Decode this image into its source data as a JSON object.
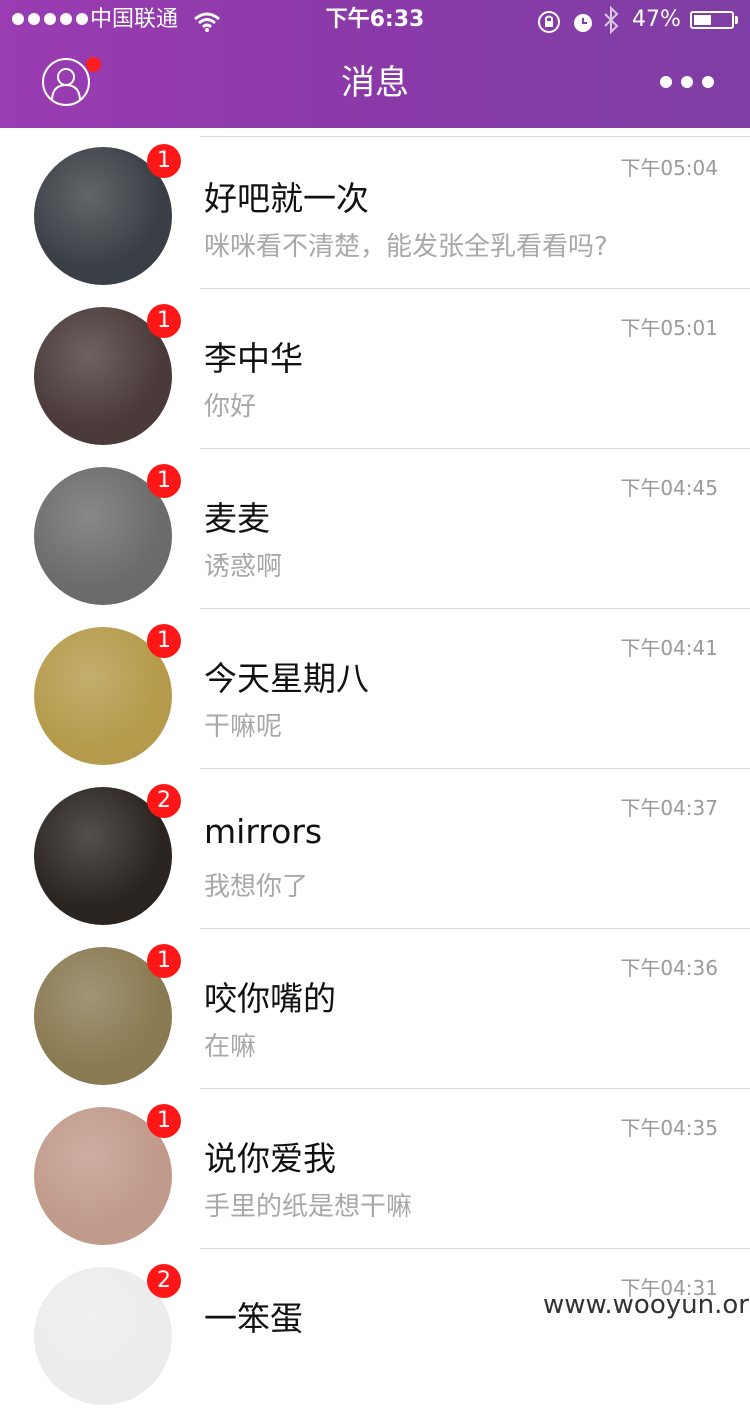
{
  "status_bar": {
    "carrier": "中国联通",
    "time": "下午6:33",
    "battery_text": "47%",
    "battery_level": 0.47
  },
  "nav": {
    "title": "消息",
    "profile_icon": "person-icon",
    "more_icon": "ellipsis-icon"
  },
  "conversations": [
    {
      "name": "好吧就一次",
      "preview": "咪咪看不清楚，能发张全乳看看吗?",
      "time": "下午05:04",
      "unread": "1",
      "avatar_color": "#3a3f45"
    },
    {
      "name": "李中华",
      "preview": "你好",
      "time": "下午05:01",
      "unread": "1",
      "avatar_color": "#4a3a3a"
    },
    {
      "name": "麦麦",
      "preview": "诱惑啊",
      "time": "下午04:45",
      "unread": "1",
      "avatar_color": "#6b6b6b"
    },
    {
      "name": "今天星期八",
      "preview": "干嘛呢",
      "time": "下午04:41",
      "unread": "1",
      "avatar_color": "#b49a4a"
    },
    {
      "name": "mirrors",
      "preview": "我想你了",
      "time": "下午04:37",
      "unread": "2",
      "avatar_color": "#2a2420"
    },
    {
      "name": "咬你嘴的",
      "preview": "在嘛",
      "time": "下午04:36",
      "unread": "1",
      "avatar_color": "#8a7a52"
    },
    {
      "name": "说你爱我",
      "preview": "手里的纸是想干嘛",
      "time": "下午04:35",
      "unread": "1",
      "avatar_color": "#c09a8a"
    },
    {
      "name": "一笨蛋",
      "preview": "",
      "time": "下午04:31",
      "unread": "2",
      "avatar_color": "#ececec"
    }
  ],
  "watermark": "www.wooyun.org"
}
